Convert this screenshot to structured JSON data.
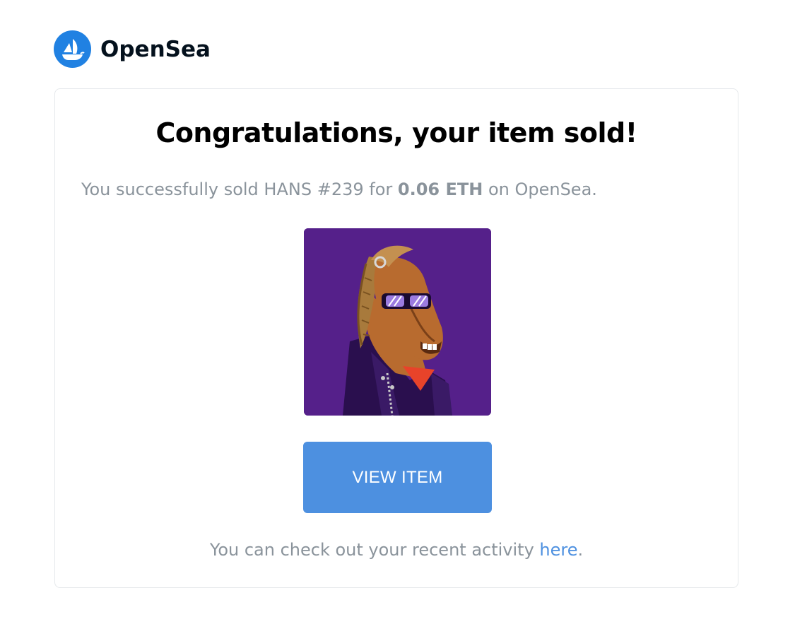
{
  "brand": {
    "name": "OpenSea",
    "logo_icon": "opensea-ship-icon",
    "accent_color": "#2081E2"
  },
  "email": {
    "headline": "Congratulations, your item sold!",
    "sold_prefix": "You successfully sold HANS #239 for ",
    "sold_price": "0.06 ETH",
    "sold_suffix": " on OpenSea.",
    "item_image": "horse-nft-image",
    "view_button_label": "VIEW ITEM",
    "view_button_color": "#4D90E0",
    "activity_prefix": "You can check out your recent activity ",
    "activity_link": "here",
    "activity_suffix": "."
  }
}
